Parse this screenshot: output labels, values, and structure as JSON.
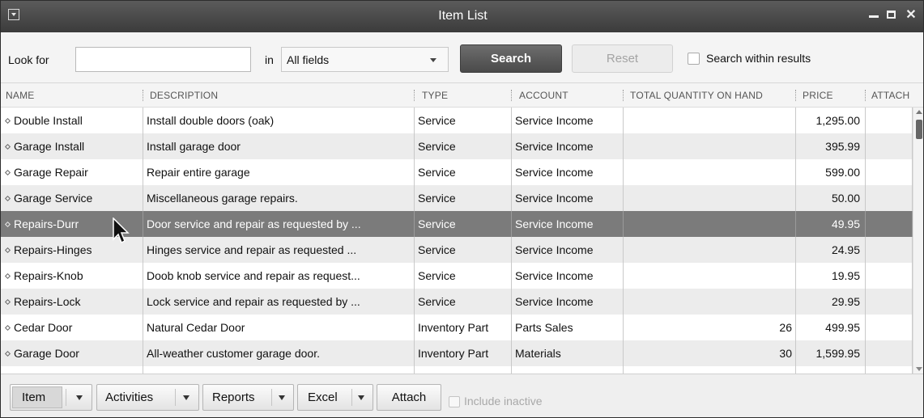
{
  "window": {
    "title": "Item List"
  },
  "search": {
    "look_for_label": "Look for",
    "look_for_value": "",
    "in_label": "in",
    "field_selected": "All fields",
    "search_button": "Search",
    "reset_button": "Reset",
    "within_results_label": "Search within results",
    "within_results_checked": false
  },
  "columns": [
    "NAME",
    "DESCRIPTION",
    "TYPE",
    "ACCOUNT",
    "TOTAL QUANTITY ON HAND",
    "PRICE",
    "ATTACH"
  ],
  "rows": [
    {
      "name": "Double Install",
      "description": "Install double doors (oak)",
      "type": "Service",
      "account": "Service Income",
      "qty": "",
      "price": "1,295.00"
    },
    {
      "name": "Garage Install",
      "description": "Install garage door",
      "type": "Service",
      "account": "Service Income",
      "qty": "",
      "price": "395.99"
    },
    {
      "name": "Garage Repair",
      "description": "Repair entire garage",
      "type": "Service",
      "account": "Service Income",
      "qty": "",
      "price": "599.00"
    },
    {
      "name": "Garage Service",
      "description": "Miscellaneous garage repairs.",
      "type": "Service",
      "account": "Service Income",
      "qty": "",
      "price": "50.00"
    },
    {
      "name": "Repairs-Durr",
      "description": "Door service and repair as requested by ...",
      "type": "Service",
      "account": "Service Income",
      "qty": "",
      "price": "49.95",
      "selected": true
    },
    {
      "name": "Repairs-Hinges",
      "description": "Hinges service and repair as requested ...",
      "type": "Service",
      "account": "Service Income",
      "qty": "",
      "price": "24.95"
    },
    {
      "name": "Repairs-Knob",
      "description": "Doob knob service and repair as request...",
      "type": "Service",
      "account": "Service Income",
      "qty": "",
      "price": "19.95"
    },
    {
      "name": "Repairs-Lock",
      "description": "Lock service and repair as requested by ...",
      "type": "Service",
      "account": "Service Income",
      "qty": "",
      "price": "29.95"
    },
    {
      "name": "Cedar Door",
      "description": "Natural Cedar Door",
      "type": "Inventory Part",
      "account": "Parts Sales",
      "qty": "26",
      "price": "499.95"
    },
    {
      "name": "Garage Door",
      "description": "All-weather customer garage door.",
      "type": "Inventory Part",
      "account": "Materials",
      "qty": "30",
      "price": "1,599.95"
    },
    {
      "name": "",
      "description": "",
      "type": "",
      "account": "",
      "qty": "",
      "price": ""
    }
  ],
  "bottom": {
    "item": "Item",
    "activities": "Activities",
    "reports": "Reports",
    "excel": "Excel",
    "attach": "Attach",
    "include_inactive": "Include inactive",
    "include_inactive_checked": false
  },
  "icons": {
    "system_menu": "system-menu-icon",
    "minimize": "minimize-icon",
    "maximize": "maximize-icon",
    "close": "close-icon",
    "row_marker": "diamond-bullet-icon",
    "pointer": "mouse-pointer-icon"
  },
  "colors": {
    "titlebar": "#4a4a4a",
    "search_button": "#5a5a5a",
    "selected_row": "#7b7b7b",
    "alt_row": "#ececec"
  }
}
